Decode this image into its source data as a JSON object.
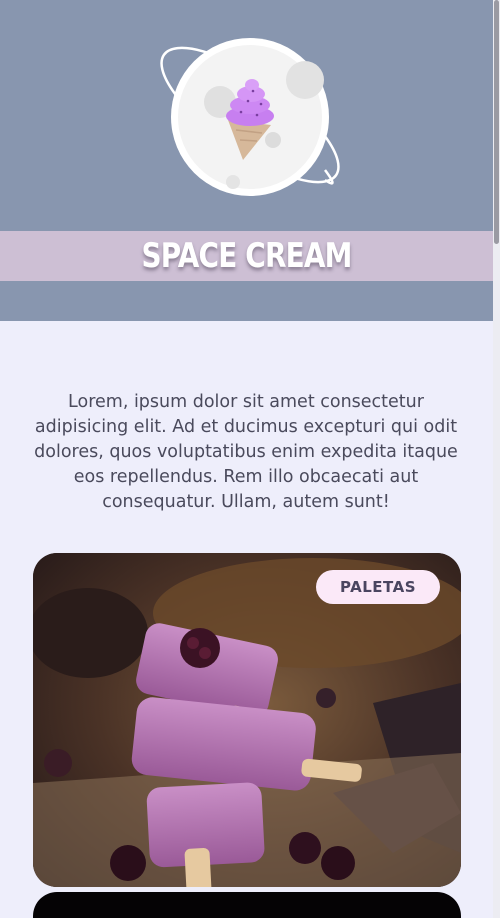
{
  "brand": {
    "name": "SPACE CREAM",
    "logo_icon": "ice-cream-planet-icon"
  },
  "intro": {
    "text": "Lorem, ipsum dolor sit amet consectetur adipisicing elit. Ad et ducimus excepturi qui odit dolores, quos voluptatibus enim expedita itaque eos repellendus. Rem illo obcaecati aut consequatur. Ullam, autem sunt!"
  },
  "products": [
    {
      "badge": "PALETAS",
      "image": "berry-popsicles-photo"
    },
    {
      "badge": "",
      "image": "dark-product-photo"
    }
  ],
  "colors": {
    "header": "#8896af",
    "brand_band": "#cdbfd4",
    "page_background": "#eeeefb",
    "badge_background": "#fbe9f8",
    "text": "#4a4a5c"
  }
}
